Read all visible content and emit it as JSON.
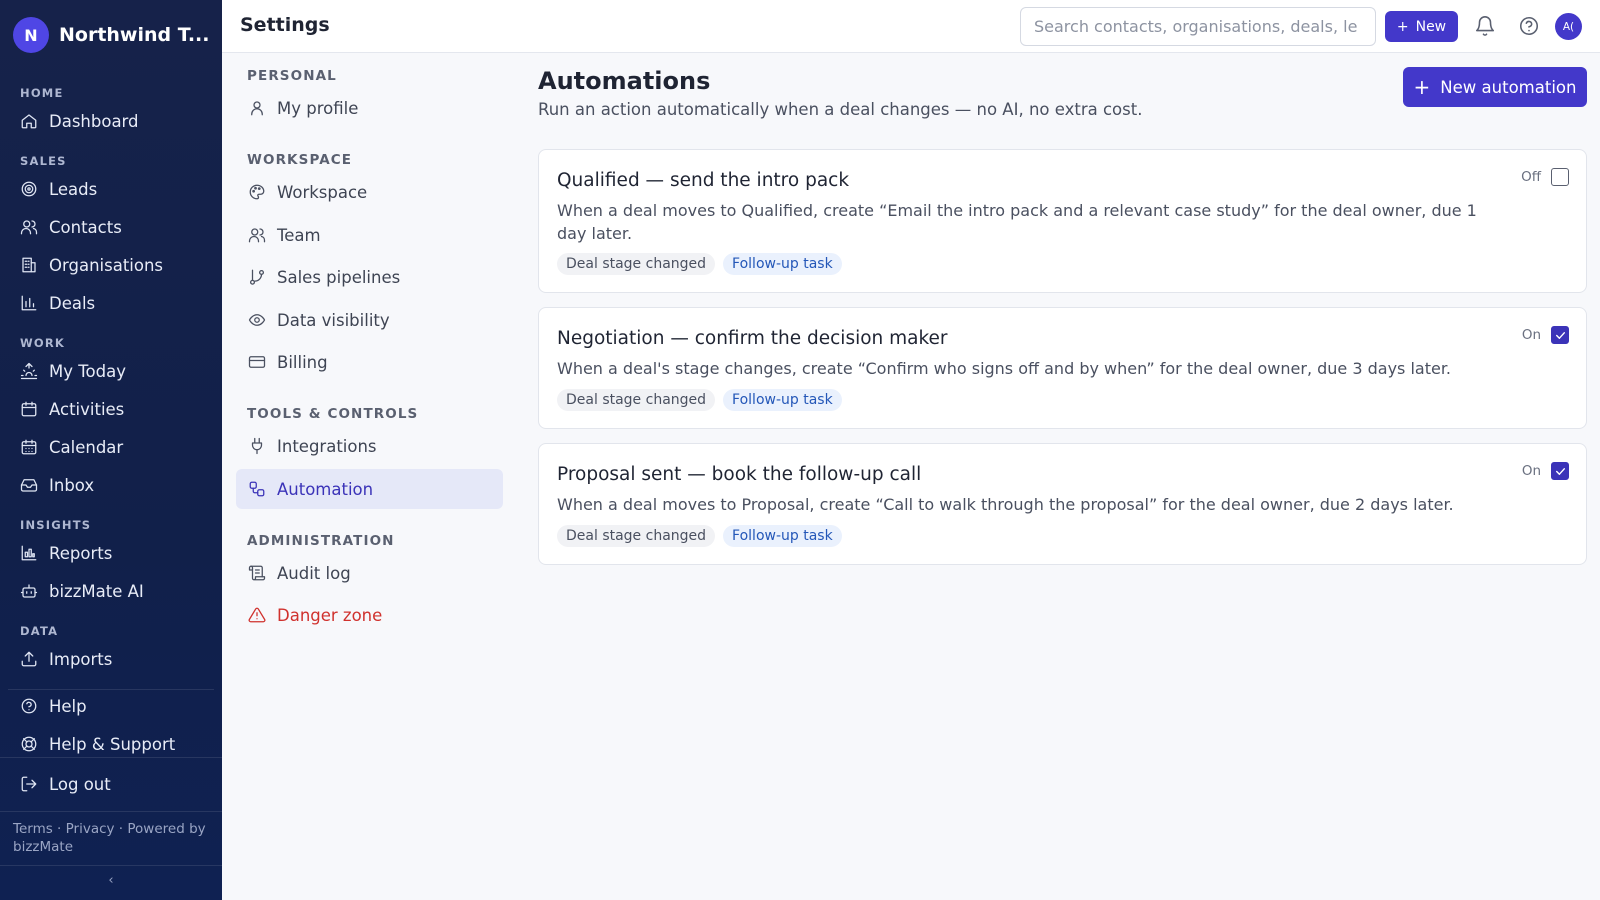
{
  "brand": {
    "initial": "N",
    "name": "Northwind T..."
  },
  "sidebar": {
    "sections": [
      {
        "label": "HOME"
      },
      {
        "label": "SALES"
      },
      {
        "label": "WORK"
      },
      {
        "label": "INSIGHTS"
      },
      {
        "label": "DATA"
      }
    ],
    "items": [
      {
        "label": "Dashboard",
        "icon": "home-icon"
      },
      {
        "label": "Leads",
        "icon": "target-icon"
      },
      {
        "label": "Contacts",
        "icon": "users-icon"
      },
      {
        "label": "Organisations",
        "icon": "building-icon"
      },
      {
        "label": "Deals",
        "icon": "bar-chart-icon"
      },
      {
        "label": "My Today",
        "icon": "sunrise-icon"
      },
      {
        "label": "Activities",
        "icon": "calendar-icon"
      },
      {
        "label": "Calendar",
        "icon": "calendar-days-icon"
      },
      {
        "label": "Inbox",
        "icon": "inbox-icon"
      },
      {
        "label": "Reports",
        "icon": "reports-icon"
      },
      {
        "label": "bizzMate AI",
        "icon": "bot-icon"
      },
      {
        "label": "Imports",
        "icon": "upload-icon"
      }
    ],
    "bottom": {
      "help": "Help",
      "support": "Help & Support",
      "logout": "Log out"
    },
    "footer": "Terms · Privacy · Powered by bizzMate",
    "collapse": "‹"
  },
  "header": {
    "title": "Settings",
    "search_placeholder": "Search contacts, organisations, deals, le",
    "new_label": "New",
    "avatar": "A("
  },
  "settings_nav": {
    "sections": {
      "personal": "PERSONAL",
      "workspace": "WORKSPACE",
      "tools": "TOOLS & CONTROLS",
      "admin": "ADMINISTRATION"
    },
    "items": {
      "my_profile": "My profile",
      "workspace": "Workspace",
      "team": "Team",
      "pipelines": "Sales pipelines",
      "visibility": "Data visibility",
      "billing": "Billing",
      "integrations": "Integrations",
      "automation": "Automation",
      "audit": "Audit log",
      "danger": "Danger zone"
    }
  },
  "main": {
    "title": "Automations",
    "subtitle": "Run an action automatically when a deal changes — no AI, no extra cost.",
    "new_button": "New automation",
    "automations": [
      {
        "title": "Qualified — send the intro pack",
        "description": "When a deal moves to Qualified, create “Email the intro pack and a relevant case study” for the deal owner, due 1 day later.",
        "trigger": "Deal stage changed",
        "action": "Follow-up task",
        "status": "Off",
        "enabled": false
      },
      {
        "title": "Negotiation — confirm the decision maker",
        "description": "When a deal's stage changes, create “Confirm who signs off and by when” for the deal owner, due 3 days later.",
        "trigger": "Deal stage changed",
        "action": "Follow-up task",
        "status": "On",
        "enabled": true
      },
      {
        "title": "Proposal sent — book the follow-up call",
        "description": "When a deal moves to Proposal, create “Call to walk through the proposal” for the deal owner, due 2 days later.",
        "trigger": "Deal stage changed",
        "action": "Follow-up task",
        "status": "On",
        "enabled": true
      }
    ]
  }
}
